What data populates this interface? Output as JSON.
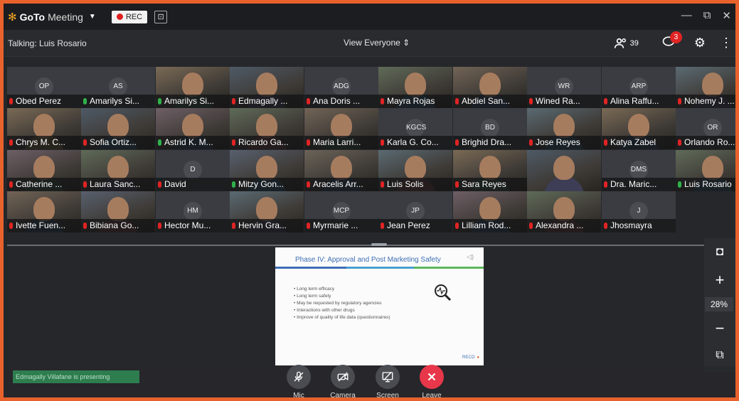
{
  "app": {
    "brand_bold": "GoTo",
    "brand_thin": "Meeting",
    "rec_label": "REC"
  },
  "header": {
    "talking": "Talking: Luis Rosario",
    "view": "View Everyone",
    "attendee_count": "39",
    "chat_badge": "3"
  },
  "participants": [
    {
      "name": "Obed Perez",
      "initials": "OP",
      "video": false,
      "mic": "muted"
    },
    {
      "name": "Amarilys Si...",
      "initials": "AS",
      "video": false,
      "mic": "on"
    },
    {
      "name": "Amarilys Si...",
      "initials": "",
      "video": true,
      "mic": "on"
    },
    {
      "name": "Edmagally ...",
      "initials": "",
      "video": true,
      "mic": "muted"
    },
    {
      "name": "Ana Doris ...",
      "initials": "ADG",
      "video": false,
      "mic": "muted"
    },
    {
      "name": "Mayra Rojas",
      "initials": "",
      "video": true,
      "mic": "muted"
    },
    {
      "name": "Abdiel San...",
      "initials": "",
      "video": true,
      "mic": "muted"
    },
    {
      "name": "Wined Ra...",
      "initials": "WR",
      "video": false,
      "mic": "muted"
    },
    {
      "name": "Alina Raffu...",
      "initials": "ARP",
      "video": false,
      "mic": "muted"
    },
    {
      "name": "Nohemy J. ...",
      "initials": "",
      "video": true,
      "mic": "muted"
    },
    {
      "name": "Chrys M. C...",
      "initials": "",
      "video": true,
      "mic": "muted"
    },
    {
      "name": "Sofia Ortiz...",
      "initials": "",
      "video": true,
      "mic": "muted"
    },
    {
      "name": "Astrid K. M...",
      "initials": "",
      "video": true,
      "mic": "on"
    },
    {
      "name": "Ricardo Ga...",
      "initials": "",
      "video": true,
      "mic": "muted"
    },
    {
      "name": "Maria Larri...",
      "initials": "",
      "video": true,
      "mic": "muted"
    },
    {
      "name": "Karla G. Co...",
      "initials": "KGCS",
      "video": false,
      "mic": "muted"
    },
    {
      "name": "Brighid Dra...",
      "initials": "BD",
      "video": false,
      "mic": "muted"
    },
    {
      "name": "Jose Reyes",
      "initials": "",
      "video": true,
      "mic": "muted"
    },
    {
      "name": "Katya Zabel",
      "initials": "",
      "video": true,
      "mic": "muted"
    },
    {
      "name": "Orlando Ro...",
      "initials": "OR",
      "video": false,
      "mic": "muted"
    },
    {
      "name": "Catherine ...",
      "initials": "",
      "video": true,
      "mic": "muted"
    },
    {
      "name": "Laura Sanc...",
      "initials": "",
      "video": true,
      "mic": "muted"
    },
    {
      "name": "David",
      "initials": "D",
      "video": false,
      "mic": "muted"
    },
    {
      "name": "Mitzy Gon...",
      "initials": "",
      "video": true,
      "mic": "on"
    },
    {
      "name": "Aracelis Arr...",
      "initials": "",
      "video": true,
      "mic": "muted"
    },
    {
      "name": "Luis Solis",
      "initials": "",
      "video": true,
      "mic": "muted"
    },
    {
      "name": "Sara Reyes",
      "initials": "",
      "video": true,
      "mic": "muted"
    },
    {
      "name": "",
      "initials": "",
      "video": true,
      "mic": ""
    },
    {
      "name": "Dra. Maric...",
      "initials": "DMS",
      "video": false,
      "mic": "muted"
    },
    {
      "name": "Luis Rosario",
      "initials": "",
      "video": true,
      "mic": "on"
    },
    {
      "name": "Ivette Fuen...",
      "initials": "",
      "video": true,
      "mic": "muted"
    },
    {
      "name": "Bibiana Go...",
      "initials": "",
      "video": true,
      "mic": "muted"
    },
    {
      "name": "Hector Mu...",
      "initials": "HM",
      "video": false,
      "mic": "muted"
    },
    {
      "name": "Hervin Gra...",
      "initials": "",
      "video": true,
      "mic": "muted"
    },
    {
      "name": "Myrmarie ...",
      "initials": "MCP",
      "video": false,
      "mic": "muted"
    },
    {
      "name": "Jean Perez",
      "initials": "JP",
      "video": false,
      "mic": "muted"
    },
    {
      "name": "Lilliam Rod...",
      "initials": "",
      "video": true,
      "mic": "muted"
    },
    {
      "name": "Alexandra ...",
      "initials": "",
      "video": true,
      "mic": "muted"
    },
    {
      "name": "Jhosmayra",
      "initials": "J",
      "video": false,
      "mic": "muted"
    }
  ],
  "slide": {
    "title": "Phase IV: Approval and Post Marketing Safety",
    "bullets": [
      "• Long term efficacy",
      "• Long term safety",
      "• May be requested by regulatory agencies",
      "• Interactions with other drugs",
      "• Improve of quality of life data (questionnaires)"
    ],
    "logo_text": "RECO"
  },
  "presenting": "Edmagally Villafane is presenting",
  "controls": {
    "mic": "Mic",
    "camera": "Camera",
    "screen": "Screen",
    "leave": "Leave"
  },
  "zoom": "28%",
  "colors": {
    "accent": "#e8622c",
    "muted": "#e02424",
    "leave": "#e8374a"
  }
}
